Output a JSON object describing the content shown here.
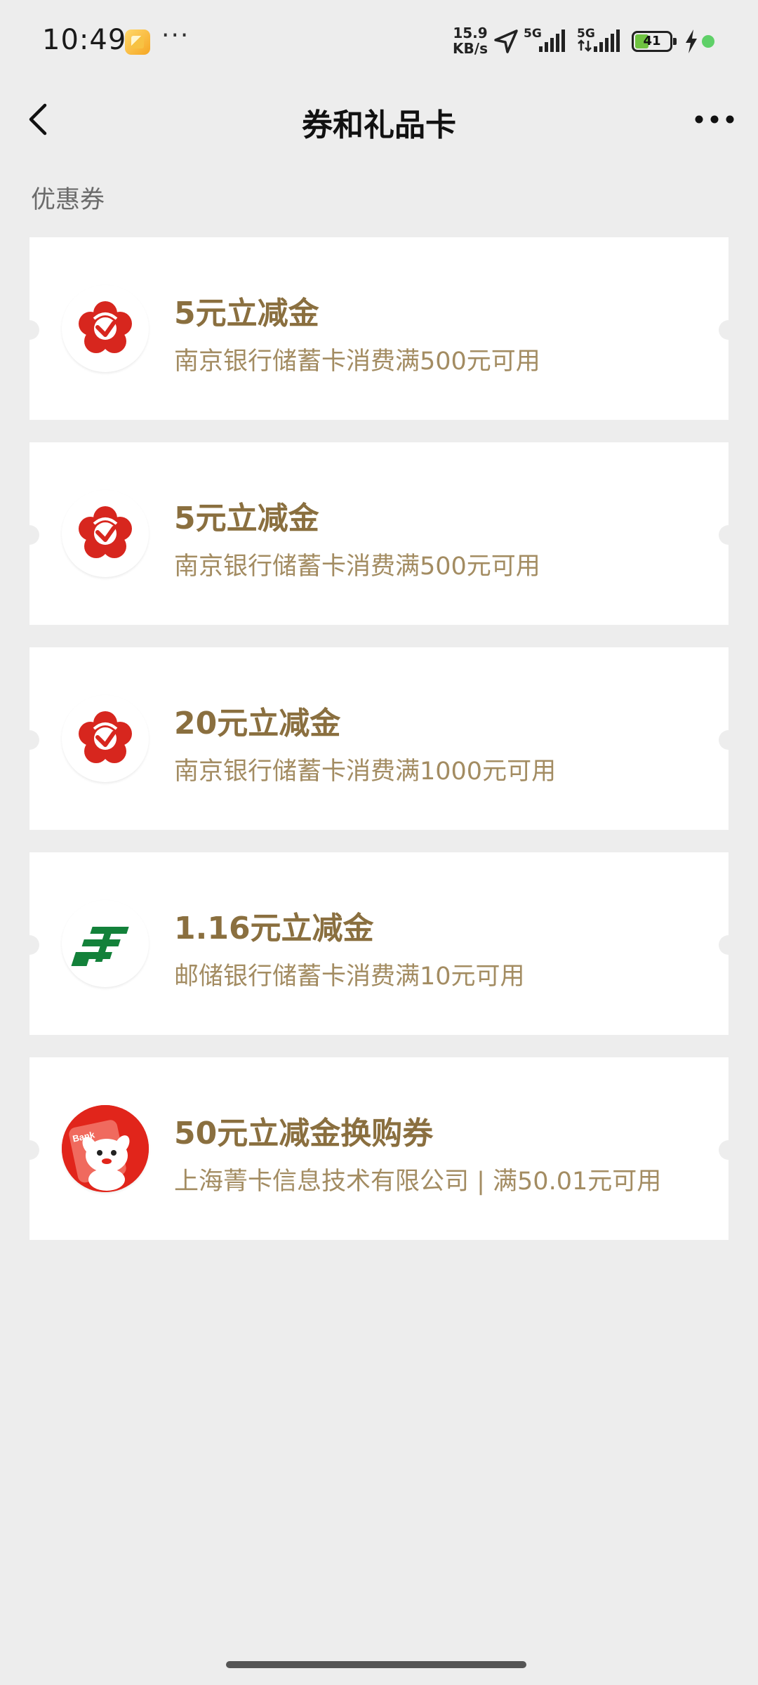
{
  "status_bar": {
    "time": "10:49",
    "net_speed_value": "15.9",
    "net_speed_unit": "KB/s",
    "signal_1_label": "5G",
    "signal_2_label": "5G",
    "battery_level": "41",
    "battery_fill_percent": 41,
    "more_dots": "···"
  },
  "nav": {
    "title": "券和礼品卡"
  },
  "section": {
    "title": "优惠券"
  },
  "coupons": [
    {
      "logo": "nanjing-bank-logo",
      "title": "5元立减金",
      "desc": "南京银行储蓄卡消费满500元可用"
    },
    {
      "logo": "nanjing-bank-logo",
      "title": "5元立减金",
      "desc": "南京银行储蓄卡消费满500元可用"
    },
    {
      "logo": "nanjing-bank-logo",
      "title": "20元立减金",
      "desc": "南京银行储蓄卡消费满1000元可用"
    },
    {
      "logo": "postal-savings-bank-logo",
      "title": "1.16元立减金",
      "desc": "邮储银行储蓄卡消费满10元可用"
    },
    {
      "logo": "jd-mascot-logo",
      "title": "50元立减金换购券",
      "desc": "上海菁卡信息技术有限公司 | 满50.01元可用",
      "logo_text": "Bank"
    }
  ],
  "colors": {
    "background": "#ededed",
    "card": "#ffffff",
    "coupon_title": "#8a6f3f",
    "coupon_desc": "#a38c62",
    "nanjing_red": "#d7261e",
    "postal_green": "#13813a",
    "jd_red": "#e1251b"
  }
}
